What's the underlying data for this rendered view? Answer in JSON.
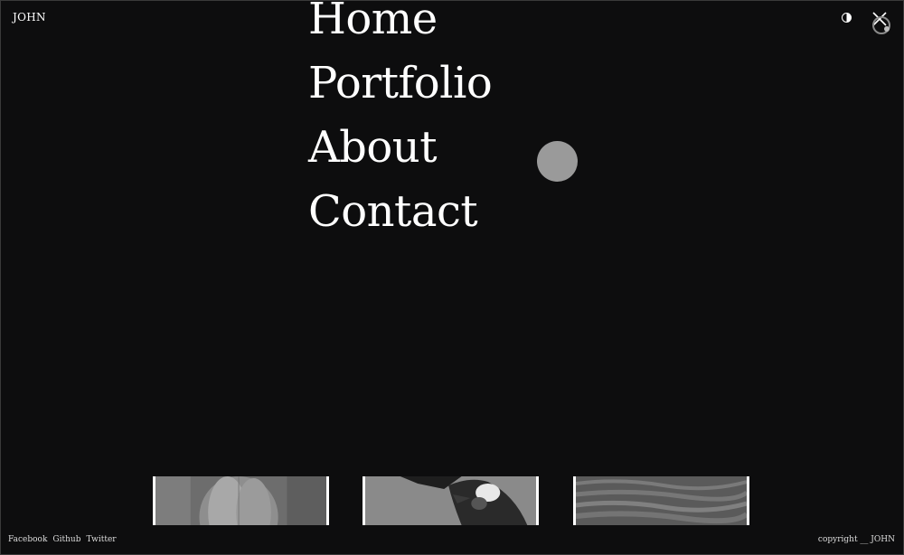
{
  "header": {
    "logo": "JOHN",
    "theme_toggle_icon": "half-circle-contrast-icon",
    "close_icon": "close-x-icon"
  },
  "menu": {
    "items": [
      {
        "label": "Home"
      },
      {
        "label": "Portfolio"
      },
      {
        "label": "About"
      },
      {
        "label": "Contact"
      }
    ]
  },
  "thumbnails": [
    {
      "subject": "tulip"
    },
    {
      "subject": "bird"
    },
    {
      "subject": "water"
    }
  ],
  "footer": {
    "links": [
      "Facebook",
      "Github",
      "Twitter"
    ],
    "copyright": "copyright __ JOHN"
  },
  "colors": {
    "background": "#0d0d0e",
    "text": "#ffffff",
    "blob": "#9a9a9a"
  }
}
